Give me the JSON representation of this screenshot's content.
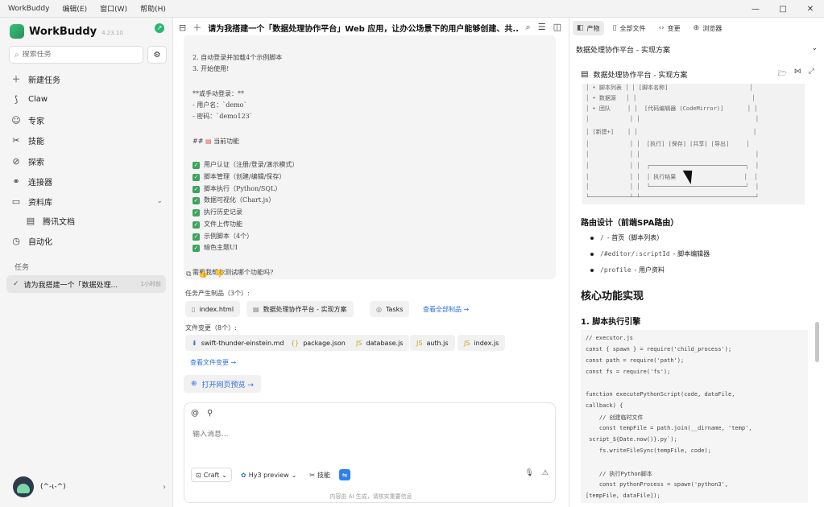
{
  "menubar": {
    "app": "WorkBuddy",
    "items": [
      "编辑(E)",
      "窗口(W)",
      "帮助(H)"
    ]
  },
  "window_controls": {
    "minimize": "—",
    "maximize": "□",
    "close": "✕"
  },
  "brand": {
    "name": "WorkBuddy",
    "version": "4.23.10"
  },
  "sidebar": {
    "search_placeholder": "搜索任务",
    "nav": [
      {
        "icon": "＋",
        "label": "新建任务"
      },
      {
        "icon": "⟆",
        "label": "Claw"
      },
      {
        "icon": "☺",
        "label": "专家"
      },
      {
        "icon": "✂",
        "label": "技能"
      },
      {
        "icon": "⊘",
        "label": "探索"
      },
      {
        "icon": "⚭",
        "label": "连接器"
      },
      {
        "icon": "▭",
        "label": "资料库"
      },
      {
        "icon": "▤",
        "label": "腾讯文档"
      },
      {
        "icon": "◷",
        "label": "自动化"
      }
    ],
    "tasks_title": "任务",
    "task": {
      "label": "请为我搭建一个「数据处理...",
      "time": "1小时前"
    },
    "user": {
      "name": "(^-ι-^)"
    }
  },
  "chat": {
    "title": "请为我搭建一个「数据处理协作平台」Web 应用，让办公场景下的用户能够创建、共...",
    "message": {
      "lines_top": [
        "2. 自动登录并加载4个示例脚本",
        "3. 开始使用!"
      ],
      "login_title": "**或手动登录：**",
      "login_user": "- 用户名：`demo`",
      "login_pwd": "- 密码：`demo123`",
      "features_heading": "当前功能",
      "features": [
        "用户认证（注册/登录/演示模式）",
        "脚本管理（创建/编辑/保存）",
        "脚本执行（Python/SQL）",
        "数据可视化（Chart.js）",
        "执行历史记录",
        "文件上传功能",
        "示例脚本（4个）",
        "暗色主题UI"
      ],
      "question": "需要我帮你测试哪个功能吗?"
    },
    "artifacts_title": "任务产生制品（3个）:",
    "artifacts": [
      "index.html",
      "数据处理协作平台 - 实现方案",
      "Tasks"
    ],
    "view_all_artifacts": "查看全部制品 →",
    "file_changes_title": "文件变更（8个）:",
    "files": [
      "swift-thunder-einstein.md",
      "package.json",
      "database.js",
      "auth.js",
      "index.js"
    ],
    "view_changes": "查看文件变更 →",
    "open_preview": "打开网页预览 →",
    "input_placeholder": "输入消息...",
    "mode": "Craft",
    "model": "Hy3 preview",
    "skills": "技能",
    "disclaimer": "内容由 AI 生成，请核实重要信息"
  },
  "right_panel": {
    "tabs": [
      "产物",
      "全部文件",
      "变更",
      "浏览器"
    ],
    "selector": "数据处理协作平台 - 实现方案",
    "doc_title": "数据处理协作平台 - 实现方案",
    "ascii_rows": [
      "│ • 脚本列表 │ │ [脚本名称]                        │",
      "│ • 数据源   │ │                                  │",
      "│ • 团队     │ │  [代码编辑器 (CodeMirror)]       │ │",
      "│            │ │                                  │",
      "│ [新建+]    │ │                                  │",
      "│            │ │  [执行] [保存] [共享] [导出]     │",
      "│            │ │                                  │",
      "│            │ │  ┌────────────────────────────┐  │",
      "│            │ │  │ 执行结果                    │  │",
      "│            │ │  └────────────────────────────┘  │",
      "└────────────┴─┴──────────────────────────────────┘"
    ],
    "route_heading": "路由设计（前端SPA路由）",
    "routes": [
      {
        "code": "/",
        "label": "- 首页（脚本列表）"
      },
      {
        "code": "/#editor/:scriptId",
        "label": "- 脚本编辑器"
      },
      {
        "code": "/profile",
        "label": "- 用户资料"
      }
    ],
    "core_heading": "核心功能实现",
    "sub_heading": "1. 脚本执行引擎",
    "code": [
      "// executor.js",
      "const { spawn } = require('child_process');",
      "const path = require('path');",
      "const fs = require('fs');",
      "",
      "function executePythonScript(code, dataFile,",
      "callback) {",
      "    // 创建临时文件",
      "    const tempFile = path.join(__dirname, 'temp',",
      " script_${Date.now()}.py`);",
      "    fs.writeFileSync(tempFile, code);",
      "",
      "    // 执行Python脚本",
      "    const pythonProcess = spawn('python3',",
      "[tempFile, dataFile]);"
    ]
  }
}
